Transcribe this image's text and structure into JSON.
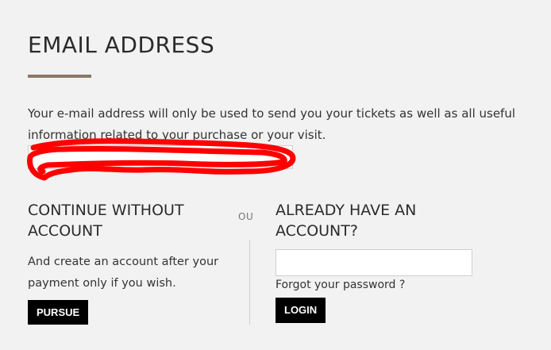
{
  "header": {
    "title": "EMAIL ADDRESS"
  },
  "intro": {
    "text": "Your e-mail address will only be used to send you your tickets as well as all useful information related to your purchase or your visit."
  },
  "email_field": {
    "value": "",
    "redaction_color": "#ff0000"
  },
  "guest": {
    "title": "CONTINUE WITHOUT ACCOUNT",
    "description": "And create an account after your payment only if you wish.",
    "button_label": "PURSUE"
  },
  "separator": {
    "label": "OU"
  },
  "login": {
    "title": "ALREADY HAVE AN ACCOUNT?",
    "input_value": "",
    "forgot_label": "Forgot your password ?",
    "button_label": "LOGIN"
  },
  "colors": {
    "accent": "#8a7866",
    "background": "#f2f2f2",
    "button_bg": "#000000"
  }
}
